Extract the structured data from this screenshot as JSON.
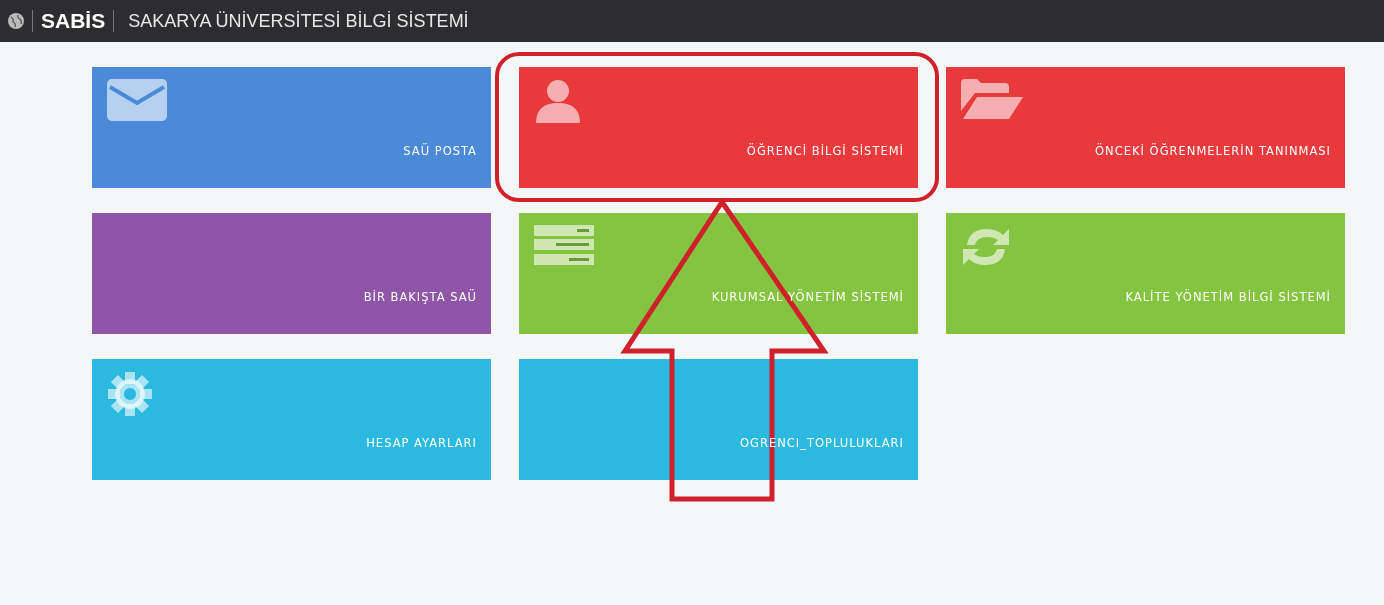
{
  "header": {
    "brand": "SABİS",
    "title": "SAKARYA ÜNİVERSİTESİ BİLGİ SİSTEMİ"
  },
  "tiles": [
    {
      "label": "SAÜ POSTA",
      "color": "#4a8ad9",
      "kind": "mail"
    },
    {
      "label": "ÖĞRENCİ BİLGİ SİSTEMİ",
      "color": "#e8393c",
      "kind": "user"
    },
    {
      "label": "ÖNCEKİ ÖĞRENMELERİN TANINMASI",
      "color": "#e8393c",
      "kind": "folder"
    },
    {
      "label": "BİR BAKIŞTA SAÜ",
      "color": "#8e55a8",
      "kind": "none"
    },
    {
      "label": "KURUMSAL YÖNETİM SİSTEMİ",
      "color": "#85c441",
      "kind": "server"
    },
    {
      "label": "KALİTE YÖNETİM BİLGİ SİSTEMİ",
      "color": "#85c441",
      "kind": "refresh"
    },
    {
      "label": "HESAP AYARLARI",
      "color": "#2bb9e0",
      "kind": "gear"
    },
    {
      "label": "OGRENCI_TOPLULUKLARI",
      "color": "#2bb9e0",
      "kind": "none"
    }
  ],
  "annotations": {
    "highlight_outline": true,
    "arrow": true
  }
}
